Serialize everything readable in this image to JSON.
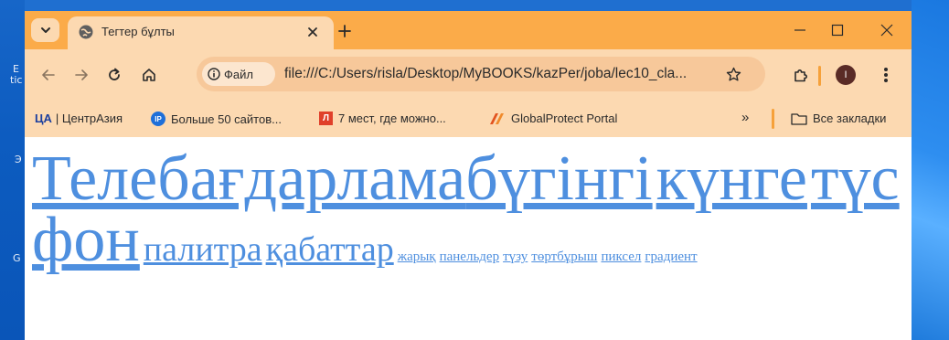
{
  "browser": {
    "tab_title": "Тегтер бұлты",
    "new_tab": "+",
    "url_chip": "Файл",
    "url": "file:///C:/Users/risla/Desktop/MyBOOKS/kazPer/joba/lec10_cla...",
    "profile_initial": "I"
  },
  "bookmarks": [
    {
      "label": "| ЦентрАзия",
      "icon": "centrasia-logo",
      "icon_text": "ЦА"
    },
    {
      "label": "Больше 50 сайтов...",
      "icon": "ip-logo",
      "icon_text": "IP"
    },
    {
      "label": "7 мест, где можно...",
      "icon": "l-logo",
      "icon_text": "Л"
    },
    {
      "label": "GlobalProtect Portal",
      "icon": "globalprotect-logo"
    },
    {
      "label": "»",
      "icon": "overflow-chevron"
    },
    {
      "label": "Все закладки",
      "icon": "folder-icon"
    }
  ],
  "desktop": {
    "left_texts": [
      "E",
      "tic",
      "Э",
      "G"
    ]
  },
  "tag_cloud": [
    {
      "text": "Телебағдарлама",
      "size": "xl"
    },
    {
      "text": "бүгінгі",
      "size": "xl"
    },
    {
      "text": "күнге",
      "size": "xl"
    },
    {
      "text": "түс",
      "size": "xl"
    },
    {
      "text": "фон",
      "size": "xl"
    },
    {
      "text": "палитра",
      "size": "l"
    },
    {
      "text": "қабаттар",
      "size": "l"
    },
    {
      "text": "жарық",
      "size": "s"
    },
    {
      "text": "панельдер",
      "size": "s"
    },
    {
      "text": "түзу",
      "size": "s"
    },
    {
      "text": "төртбұрыш",
      "size": "s"
    },
    {
      "text": "пиксел",
      "size": "s"
    },
    {
      "text": "градиент",
      "size": "s"
    }
  ],
  "colors": {
    "titlebar": "#fbab49",
    "toolbar": "#fcd9b1",
    "link": "#4e8fdf"
  }
}
